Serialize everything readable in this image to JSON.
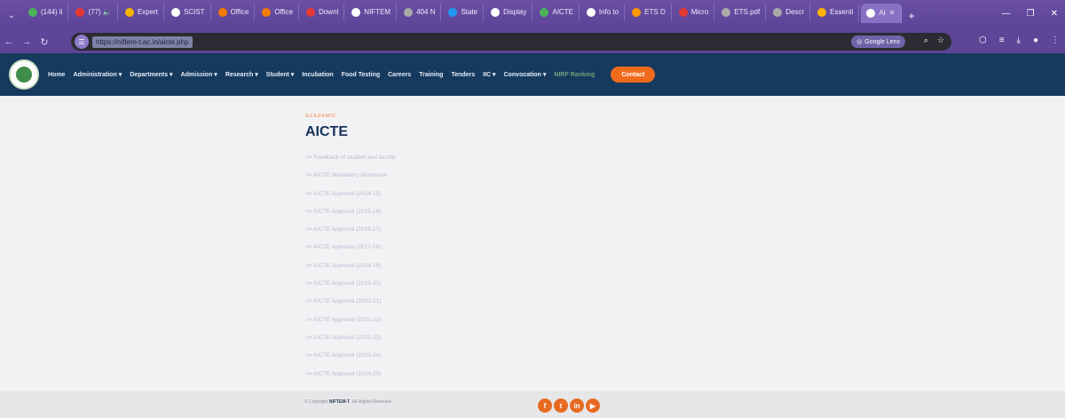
{
  "browser": {
    "tabs": [
      {
        "label": "(144) li",
        "color": "#4cb35c"
      },
      {
        "label": "(77) 🔈",
        "color": "#e53935"
      },
      {
        "label": "Expert",
        "color": "#f5b400"
      },
      {
        "label": "SCIST",
        "color": "#ffffff"
      },
      {
        "label": "Office",
        "color": "#f57c00"
      },
      {
        "label": "Office",
        "color": "#f57c00"
      },
      {
        "label": "Downl",
        "color": "#e53935"
      },
      {
        "label": "NIFTEM",
        "color": "#ffffff"
      },
      {
        "label": "404 N",
        "color": "#aaaaaa"
      },
      {
        "label": "State",
        "color": "#2196f3"
      },
      {
        "label": "Display",
        "color": "#ffffff"
      },
      {
        "label": "AICTE",
        "color": "#4cb35c"
      },
      {
        "label": "Info to",
        "color": "#ffffff"
      },
      {
        "label": "ETS D",
        "color": "#ff9800"
      },
      {
        "label": "Micro",
        "color": "#e53935"
      },
      {
        "label": "ETS.pdf",
        "color": "#aaaaaa"
      },
      {
        "label": "Descr",
        "color": "#aaaaaa"
      },
      {
        "label": "Essenti",
        "color": "#ffb300"
      },
      {
        "label": "AI",
        "color": "#ffffff"
      }
    ],
    "url": "https://niftem-t.ac.in/aicte.php",
    "lens_label": "Google Lens"
  },
  "nav": {
    "items": [
      {
        "label": "Home",
        "dim": false
      },
      {
        "label": "Administration ▾",
        "dim": false
      },
      {
        "label": "Departments ▾",
        "dim": false
      },
      {
        "label": "Admission ▾",
        "dim": false
      },
      {
        "label": "Research ▾",
        "dim": false
      },
      {
        "label": "Student ▾",
        "dim": false
      },
      {
        "label": "Incubation",
        "dim": false
      },
      {
        "label": "Food Testing",
        "dim": false
      },
      {
        "label": "Careers",
        "dim": false
      },
      {
        "label": "Training",
        "dim": false
      },
      {
        "label": "Tenders",
        "dim": false
      },
      {
        "label": "IIC ▾",
        "dim": false
      },
      {
        "label": "Convocation ▾",
        "dim": false
      },
      {
        "label": "NIRF Ranking",
        "dim": true
      }
    ],
    "contact_label": "Contact"
  },
  "content": {
    "eyebrow": "ACADEMIC",
    "title": "AICTE",
    "links": [
      ">> Feedback of student and faculty",
      ">> AICTE Mandatory disclosure",
      ">> AICTE Approval (2014-15)",
      ">> AICTE Approval (2015-16)",
      ">> AICTE Approval (2016-17)",
      ">> AICTE Approval (2017-18)",
      ">> AICTE Approval (2018-19)",
      ">> AICTE Approval (2019-20)",
      ">> AICTE Approval (2020-21)",
      ">> AICTE Approval (2021-22)",
      ">> AICTE Approval (2022-23)",
      ">> AICTE Approval (2023-24)",
      ">> AICTE Approval (2024-25)"
    ]
  },
  "footer": {
    "copyright_prefix": "© Copyright",
    "brand": "NIFTEM-T",
    "copyright_suffix": ". All Rights Reserved",
    "socials": [
      {
        "name": "facebook",
        "glyph": "f"
      },
      {
        "name": "twitter",
        "glyph": "t"
      },
      {
        "name": "linkedin",
        "glyph": "in"
      },
      {
        "name": "youtube",
        "glyph": "▶"
      }
    ]
  }
}
